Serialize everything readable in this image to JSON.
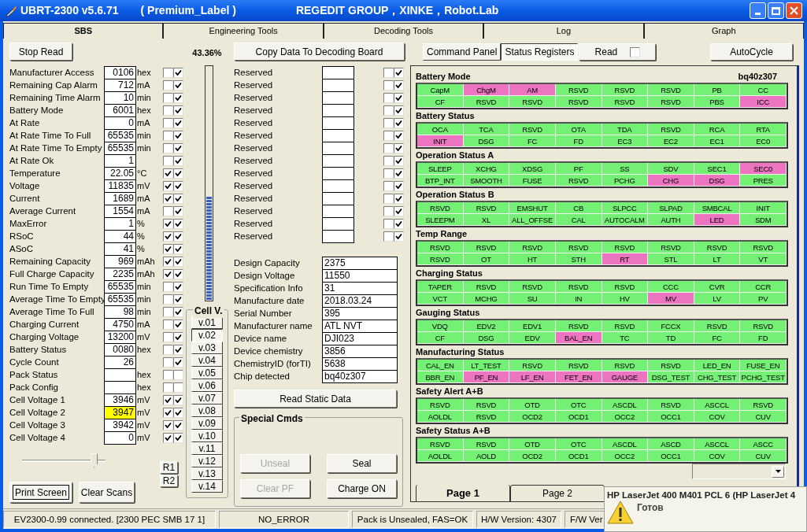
{
  "window": {
    "title": "UBRT-2300 v5.6.71",
    "label": "( Premium_Label )",
    "credits": "REGEDIT GROUP，XINKE，Robot.Lab"
  },
  "tabs": [
    {
      "label": "SBS",
      "selected": true
    },
    {
      "label": "Engineering Tools",
      "selected": false
    },
    {
      "label": "Decoding Tools",
      "selected": false
    },
    {
      "label": "Log",
      "selected": false
    },
    {
      "label": "Graph",
      "selected": false
    }
  ],
  "sbs": {
    "stop_read": "Stop Read",
    "registers": [
      {
        "label": "Manufacturer Access",
        "value": "0106",
        "unit": "hex",
        "checks": [
          false,
          true
        ],
        "highlighted": false
      },
      {
        "label": "Remaining Cap Alarm",
        "value": "712",
        "unit": "mA",
        "checks": [
          false,
          true
        ],
        "highlighted": false
      },
      {
        "label": "Remaining Time Alarm",
        "value": "10",
        "unit": "min",
        "checks": [
          false,
          true
        ],
        "highlighted": false
      },
      {
        "label": "Battery Mode",
        "value": "6001",
        "unit": "hex",
        "checks": [
          false,
          true
        ],
        "highlighted": false
      },
      {
        "label": "At Rate",
        "value": "0",
        "unit": "mA",
        "checks": [
          false,
          true
        ],
        "highlighted": false
      },
      {
        "label": "At Rate Time To Full",
        "value": "65535",
        "unit": "min",
        "checks": [
          false,
          true
        ],
        "highlighted": false
      },
      {
        "label": "At Rate Time To Empty",
        "value": "65535",
        "unit": "min",
        "checks": [
          false,
          true
        ],
        "highlighted": false
      },
      {
        "label": "At Rate Ok",
        "value": "1",
        "checks": [
          false,
          true
        ],
        "highlighted": false
      },
      {
        "label": "Temperature",
        "value": "22.05",
        "unit": "°C",
        "checks": [
          true,
          true
        ],
        "highlighted": false
      },
      {
        "label": "Voltage",
        "value": "11835",
        "unit": "mV",
        "checks": [
          true,
          true
        ],
        "highlighted": false
      },
      {
        "label": "Current",
        "value": "1689",
        "unit": "mA",
        "checks": [
          true,
          true
        ],
        "highlighted": false
      },
      {
        "label": "Average Current",
        "value": "1554",
        "unit": "mA",
        "checks": [
          false,
          true
        ],
        "highlighted": false
      },
      {
        "label": "MaxError",
        "value": "1",
        "unit": "%",
        "checks": [
          true,
          true
        ],
        "highlighted": false
      },
      {
        "label": "RSoC",
        "value": "44",
        "unit": "%",
        "checks": [
          true,
          true
        ],
        "highlighted": false
      },
      {
        "label": "ASoC",
        "value": "41",
        "unit": "%",
        "checks": [
          true,
          true
        ],
        "highlighted": false
      },
      {
        "label": "Remaining Capacity",
        "value": "969",
        "unit": "mAh",
        "checks": [
          true,
          true
        ],
        "highlighted": false
      },
      {
        "label": "Full Charge Capacity",
        "value": "2235",
        "unit": "mAh",
        "checks": [
          true,
          true
        ],
        "highlighted": false
      },
      {
        "label": "Run Time To Empty",
        "value": "65535",
        "unit": "min",
        "checks": [
          false,
          true
        ],
        "highlighted": false
      },
      {
        "label": "Average Time To Empty",
        "value": "65535",
        "unit": "min",
        "checks": [
          false,
          true
        ],
        "highlighted": false
      },
      {
        "label": "Average Time To Full",
        "value": "98",
        "unit": "min",
        "checks": [
          false,
          true
        ],
        "highlighted": false
      },
      {
        "label": "Charging Current",
        "value": "4750",
        "unit": "mA",
        "checks": [
          false,
          true
        ],
        "highlighted": false
      },
      {
        "label": "Charging Voltage",
        "value": "13200",
        "unit": "mV",
        "checks": [
          false,
          true
        ],
        "highlighted": false
      },
      {
        "label": "Battery Status",
        "value": "0080",
        "unit": "hex",
        "checks": [
          false,
          true
        ],
        "highlighted": false
      },
      {
        "label": "Cycle Count",
        "value": "26",
        "checks": [
          false,
          true
        ],
        "highlighted": false
      },
      {
        "label": "Pack Status",
        "unit": "hex",
        "checks": [
          false,
          false
        ],
        "highlighted": false
      },
      {
        "label": "Pack Config",
        "unit": "hex",
        "checks": [
          false,
          false
        ],
        "highlighted": false
      },
      {
        "label": "Cell Voltage 1",
        "value": "3946",
        "unit": "mV",
        "checks": [
          true,
          true
        ],
        "highlighted": false
      },
      {
        "label": "Cell Voltage 2",
        "value": "3947",
        "unit": "mV",
        "checks": [
          true,
          true
        ],
        "highlighted": true
      },
      {
        "label": "Cell Voltage 3",
        "value": "3942",
        "unit": "mV",
        "checks": [
          true,
          true
        ],
        "highlighted": false
      },
      {
        "label": "Cell Voltage 4",
        "value": "0",
        "unit": "mV",
        "checks": [
          true,
          true
        ],
        "highlighted": false
      }
    ],
    "progress": {
      "reading": "43.36%",
      "level": 0.44
    },
    "cell_v": {
      "title": "Cell V.",
      "buttons": [
        {
          "label": "v.01",
          "selected": false
        },
        {
          "label": "v.02",
          "selected": true
        },
        {
          "label": "v.03",
          "selected": false
        },
        {
          "label": "v.04",
          "selected": false
        },
        {
          "label": "v.05",
          "selected": false
        },
        {
          "label": "v.06",
          "selected": false
        },
        {
          "label": "v.07",
          "selected": false
        },
        {
          "label": "v.08",
          "selected": false
        },
        {
          "label": "v.09",
          "selected": false
        },
        {
          "label": "v.10",
          "selected": false
        },
        {
          "label": "v.11",
          "selected": false
        },
        {
          "label": "v.12",
          "selected": false
        },
        {
          "label": "v.13",
          "selected": false
        },
        {
          "label": "v.14",
          "selected": false
        }
      ]
    },
    "slider": {
      "level": 0.9
    },
    "r_buttons": [
      "R1",
      "R2"
    ],
    "print_screen": "Print Screen",
    "clear_scans": "Clear Scans"
  },
  "decoding": {
    "copy_button": "Copy Data To Decoding Board",
    "reserved": [
      {
        "label": "Reserved",
        "checks": [
          false,
          true
        ]
      },
      {
        "label": "Reserved",
        "checks": [
          false,
          true
        ]
      },
      {
        "label": "Reserved",
        "checks": [
          false,
          true
        ]
      },
      {
        "label": "Reserved",
        "checks": [
          false,
          true
        ]
      },
      {
        "label": "Reserved",
        "checks": [
          false,
          true
        ]
      },
      {
        "label": "Reserved",
        "checks": [
          false,
          true
        ]
      },
      {
        "label": "Reserved",
        "checks": [
          false,
          true
        ]
      },
      {
        "label": "Reserved",
        "checks": [
          false,
          true
        ]
      },
      {
        "label": "Reserved",
        "checks": [
          false,
          true
        ]
      },
      {
        "label": "Reserved",
        "checks": [
          false,
          true
        ]
      },
      {
        "label": "Reserved",
        "checks": [
          false,
          true
        ]
      },
      {
        "label": "Reserved",
        "checks": [
          false,
          true
        ]
      },
      {
        "label": "Reserved",
        "checks": [
          false,
          true
        ]
      },
      {
        "label": "Reserved",
        "checks": [
          false,
          true
        ]
      }
    ],
    "static_info": [
      {
        "label": "Design Capacity",
        "value": "2375"
      },
      {
        "label": "Design Voltage",
        "value": "11550"
      },
      {
        "label": "Specification Info",
        "value": "31"
      },
      {
        "label": "Manufacture date",
        "value": "2018.03.24"
      },
      {
        "label": "Serial Number",
        "value": "395"
      },
      {
        "label": "Manufacturer name",
        "value": "ATL NVT"
      },
      {
        "label": "Device name",
        "value": "DJI023"
      },
      {
        "label": "Device chemistry",
        "value": "3856"
      },
      {
        "label": "ChemistryID (forTI)",
        "value": "5638"
      },
      {
        "label": "Chip detected",
        "value": "bq40z307"
      }
    ],
    "read_static": "Read Static Data",
    "special_cmds": {
      "title": "Special Cmds",
      "buttons": [
        {
          "label": "Unseal",
          "disabled": true
        },
        {
          "label": "Seal",
          "disabled": false
        },
        {
          "label": "Clear PF",
          "disabled": true
        },
        {
          "label": "Charge ON",
          "disabled": false
        }
      ]
    }
  },
  "registers": {
    "panel_buttons": [
      {
        "label": "Command Panel",
        "selected": false
      },
      {
        "label": "Status Registers",
        "selected": true
      }
    ],
    "read": {
      "label": "Read",
      "checked": false
    },
    "autocycle": "AutoCycle",
    "chip": "bq40z307",
    "sections": [
      {
        "title": "Battery Mode",
        "rows": [
          [
            {
              "label": "CapM",
              "set": false
            },
            {
              "label": "ChgM",
              "set": true
            },
            {
              "label": "AM",
              "set": true
            },
            {
              "label": "RSVD",
              "set": false
            },
            {
              "label": "RSVD",
              "set": false
            },
            {
              "label": "RSVD",
              "set": false
            },
            {
              "label": "PB",
              "set": false
            },
            {
              "label": "CC",
              "set": false
            }
          ],
          [
            {
              "label": "CF",
              "set": false
            },
            {
              "label": "RSVD",
              "set": false
            },
            {
              "label": "RSVD",
              "set": false
            },
            {
              "label": "RSVD",
              "set": false
            },
            {
              "label": "RSVD",
              "set": false
            },
            {
              "label": "RSVD",
              "set": false
            },
            {
              "label": "PBS",
              "set": false
            },
            {
              "label": "ICC",
              "set": true
            }
          ]
        ]
      },
      {
        "title": "Battery Status",
        "rows": [
          [
            {
              "label": "OCA",
              "set": false
            },
            {
              "label": "TCA",
              "set": false
            },
            {
              "label": "RSVD",
              "set": false
            },
            {
              "label": "OTA",
              "set": false
            },
            {
              "label": "TDA",
              "set": false
            },
            {
              "label": "RSVD",
              "set": false
            },
            {
              "label": "RCA",
              "set": false
            },
            {
              "label": "RTA",
              "set": false
            }
          ],
          [
            {
              "label": "INIT",
              "set": true
            },
            {
              "label": "DSG",
              "set": false
            },
            {
              "label": "FC",
              "set": false
            },
            {
              "label": "FD",
              "set": false
            },
            {
              "label": "EC3",
              "set": false
            },
            {
              "label": "EC2",
              "set": false
            },
            {
              "label": "EC1",
              "set": false
            },
            {
              "label": "EC0",
              "set": false
            }
          ]
        ]
      },
      {
        "title": "Operation Status A",
        "rows": [
          [
            {
              "label": "SLEEP",
              "set": false
            },
            {
              "label": "XCHG",
              "set": false
            },
            {
              "label": "XDSG",
              "set": false
            },
            {
              "label": "PF",
              "set": false
            },
            {
              "label": "SS",
              "set": false
            },
            {
              "label": "SDV",
              "set": false
            },
            {
              "label": "SEC1",
              "set": false
            },
            {
              "label": "SEC0",
              "set": true
            }
          ],
          [
            {
              "label": "BTP_INT",
              "set": false
            },
            {
              "label": "SMOOTH",
              "set": false
            },
            {
              "label": "FUSE",
              "set": false
            },
            {
              "label": "RSVD",
              "set": false
            },
            {
              "label": "PCHG",
              "set": false
            },
            {
              "label": "CHG",
              "set": true
            },
            {
              "label": "DSG",
              "set": true
            },
            {
              "label": "PRES",
              "set": false
            }
          ]
        ]
      },
      {
        "title": "Operation Status B",
        "rows": [
          [
            {
              "label": "RSVD",
              "set": false
            },
            {
              "label": "RSVD",
              "set": false
            },
            {
              "label": "EMSHUT",
              "set": false
            },
            {
              "label": "CB",
              "set": false
            },
            {
              "label": "SLPCC",
              "set": false
            },
            {
              "label": "SLPAD",
              "set": false
            },
            {
              "label": "SMBCAL",
              "set": false
            },
            {
              "label": "INIT",
              "set": false
            }
          ],
          [
            {
              "label": "SLEEPM",
              "set": false
            },
            {
              "label": "XL",
              "set": false
            },
            {
              "label": "ALL_OFFSE",
              "set": false
            },
            {
              "label": "CAL",
              "set": false
            },
            {
              "label": "AUTOCALM",
              "set": false
            },
            {
              "label": "AUTH",
              "set": false
            },
            {
              "label": "LED",
              "set": true
            },
            {
              "label": "SDM",
              "set": false
            }
          ]
        ]
      },
      {
        "title": "Temp Range",
        "rows": [
          [
            {
              "label": "RSVD",
              "set": false
            },
            {
              "label": "RSVD",
              "set": false
            },
            {
              "label": "RSVD",
              "set": false
            },
            {
              "label": "RSVD",
              "set": false
            },
            {
              "label": "RSVD",
              "set": false
            },
            {
              "label": "RSVD",
              "set": false
            },
            {
              "label": "RSVD",
              "set": false
            },
            {
              "label": "RSVD",
              "set": false
            }
          ],
          [
            {
              "label": "RSVD",
              "set": false
            },
            {
              "label": "OT",
              "set": false
            },
            {
              "label": "HT",
              "set": false
            },
            {
              "label": "STH",
              "set": false
            },
            {
              "label": "RT",
              "set": true
            },
            {
              "label": "STL",
              "set": false
            },
            {
              "label": "LT",
              "set": false
            },
            {
              "label": "VT",
              "set": false
            }
          ]
        ]
      },
      {
        "title": "Charging Status",
        "rows": [
          [
            {
              "label": "TAPER",
              "set": false
            },
            {
              "label": "RSVD",
              "set": false
            },
            {
              "label": "RSVD",
              "set": false
            },
            {
              "label": "RSVD",
              "set": false
            },
            {
              "label": "RSVD",
              "set": false
            },
            {
              "label": "CCC",
              "set": false
            },
            {
              "label": "CVR",
              "set": false
            },
            {
              "label": "CCR",
              "set": false
            }
          ],
          [
            {
              "label": "VCT",
              "set": false
            },
            {
              "label": "MCHG",
              "set": false
            },
            {
              "label": "SU",
              "set": false
            },
            {
              "label": "IN",
              "set": false
            },
            {
              "label": "HV",
              "set": false
            },
            {
              "label": "MV",
              "set": true
            },
            {
              "label": "LV",
              "set": false
            },
            {
              "label": "PV",
              "set": false
            }
          ]
        ]
      },
      {
        "title": "Gauging Status",
        "rows": [
          [
            {
              "label": "VDQ",
              "set": false
            },
            {
              "label": "EDV2",
              "set": false
            },
            {
              "label": "EDV1",
              "set": false
            },
            {
              "label": "RSVD",
              "set": false
            },
            {
              "label": "RSVD",
              "set": false
            },
            {
              "label": "FCCX",
              "set": false
            },
            {
              "label": "RSVD",
              "set": false
            },
            {
              "label": "RSVD",
              "set": false
            }
          ],
          [
            {
              "label": "CF",
              "set": false
            },
            {
              "label": "DSG",
              "set": false
            },
            {
              "label": "EDV",
              "set": false
            },
            {
              "label": "BAL_EN",
              "set": true
            },
            {
              "label": "TC",
              "set": false
            },
            {
              "label": "TD",
              "set": false
            },
            {
              "label": "FC",
              "set": false
            },
            {
              "label": "FD",
              "set": false
            }
          ]
        ]
      },
      {
        "title": "Manufacturing Status",
        "rows": [
          [
            {
              "label": "CAL_EN",
              "set": false
            },
            {
              "label": "LT_TEST",
              "set": false
            },
            {
              "label": "RSVD",
              "set": false
            },
            {
              "label": "RSVD",
              "set": false
            },
            {
              "label": "RSVD",
              "set": false
            },
            {
              "label": "RSVD",
              "set": false
            },
            {
              "label": "LED_EN",
              "set": false
            },
            {
              "label": "FUSE_EN",
              "set": false
            }
          ],
          [
            {
              "label": "BBR_EN",
              "set": false
            },
            {
              "label": "PF_EN",
              "set": true
            },
            {
              "label": "LF_EN",
              "set": true
            },
            {
              "label": "FET_EN",
              "set": true
            },
            {
              "label": "GAUGE",
              "set": true
            },
            {
              "label": "DSG_TEST",
              "set": false
            },
            {
              "label": "CHG_TEST",
              "set": false
            },
            {
              "label": "PCHG_TEST",
              "set": false
            }
          ]
        ]
      },
      {
        "title": "Safety Alert A+B",
        "rows": [
          [
            {
              "label": "RSVD",
              "set": false
            },
            {
              "label": "RSVD",
              "set": false
            },
            {
              "label": "OTD",
              "set": false
            },
            {
              "label": "OTC",
              "set": false
            },
            {
              "label": "ASCDL",
              "set": false
            },
            {
              "label": "RSVD",
              "set": false
            },
            {
              "label": "ASCCL",
              "set": false
            },
            {
              "label": "RSVD",
              "set": false
            }
          ],
          [
            {
              "label": "AOLDL",
              "set": false
            },
            {
              "label": "RSVD",
              "set": false
            },
            {
              "label": "OCD2",
              "set": false
            },
            {
              "label": "OCD1",
              "set": false
            },
            {
              "label": "OCC2",
              "set": false
            },
            {
              "label": "OCC1",
              "set": false
            },
            {
              "label": "COV",
              "set": false
            },
            {
              "label": "CUV",
              "set": false
            }
          ]
        ]
      },
      {
        "title": "Safety Status A+B",
        "rows": [
          [
            {
              "label": "RSVD",
              "set": false
            },
            {
              "label": "RSVD",
              "set": false
            },
            {
              "label": "OTD",
              "set": false
            },
            {
              "label": "OTC",
              "set": false
            },
            {
              "label": "ASCDL",
              "set": false
            },
            {
              "label": "ASCD",
              "set": false
            },
            {
              "label": "ASCCL",
              "set": false
            },
            {
              "label": "ASCC",
              "set": false
            }
          ],
          [
            {
              "label": "AOLDL",
              "set": false
            },
            {
              "label": "AOLD",
              "set": false
            },
            {
              "label": "OCD2",
              "set": false
            },
            {
              "label": "OCD1",
              "set": false
            },
            {
              "label": "OCC2",
              "set": false
            },
            {
              "label": "OCC1",
              "set": false
            },
            {
              "label": "COV",
              "set": false
            },
            {
              "label": "CUV",
              "set": false
            }
          ]
        ]
      }
    ],
    "page_tabs": [
      {
        "label": "Page 1",
        "selected": true
      },
      {
        "label": "Page 2",
        "selected": false
      }
    ]
  },
  "status_bar": [
    "EV2300-0.99 connected. [2300  PEC  SMB  17 1]",
    "NO_ERROR",
    "Pack is Unsealed, FAS=OK",
    "H/W Version: 4307",
    "F/W Ver"
  ],
  "notification": {
    "title": "HP LaserJet 400 M401 PCL 6 (HP LaserJet 4",
    "message": "Готов"
  }
}
